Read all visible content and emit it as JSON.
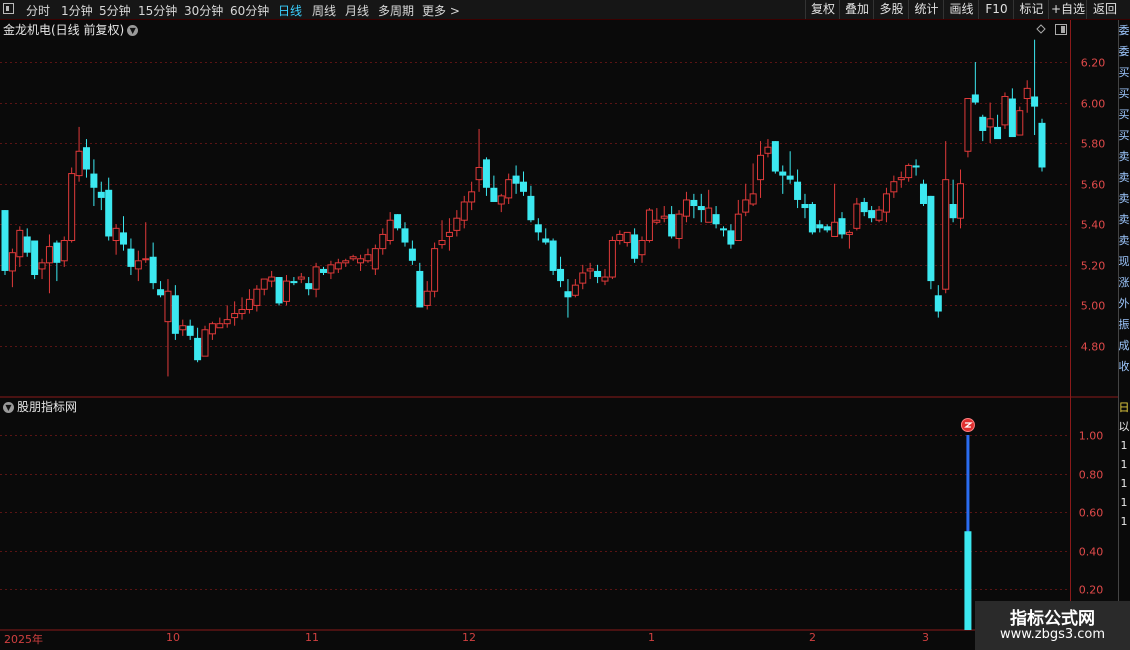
{
  "toolbar": {
    "left_items": [
      "分时",
      "1分钟",
      "5分钟",
      "15分钟",
      "30分钟",
      "60分钟",
      "日线",
      "周线",
      "月线",
      "多周期",
      "更多 >"
    ],
    "active_item": "日线",
    "right_items": [
      "复权",
      "叠加",
      "多股",
      "统计",
      "画线",
      "F10",
      "标记",
      "+自选",
      "返回"
    ]
  },
  "main_chart": {
    "title": "金龙机电(日线 前复权)",
    "price_ticks": [
      "6.20",
      "6.00",
      "5.80",
      "5.60",
      "5.40",
      "5.20",
      "5.00",
      "4.80"
    ],
    "up_color": "#e03a3a",
    "down_color": "#3ce8f0"
  },
  "indicator": {
    "title": "股朋指标网",
    "ticks": [
      "1.00",
      "0.80",
      "0.60",
      "0.40",
      "0.20"
    ],
    "signal_value": 1,
    "bar_value": 0.5
  },
  "date_axis": [
    "2025年",
    "10",
    "11",
    "12",
    "1",
    "2",
    "3"
  ],
  "right_strip": {
    "top_chars": [
      "委",
      "委",
      "买",
      "买",
      "买",
      "买",
      "卖",
      "卖",
      "卖",
      "卖",
      "卖",
      "现",
      "涨",
      "外",
      "振",
      "成",
      "收"
    ],
    "bottom_chars": [
      "日",
      "以",
      "1",
      "1",
      "1",
      "1",
      "1"
    ]
  },
  "watermark": {
    "title": "指标公式网",
    "url": "www.zbgs3.com"
  },
  "chart_data": {
    "type": "candlestick",
    "title": "金龙机电(日线 前复权)",
    "ylim": [
      4.6,
      6.3
    ],
    "xlabel_ticks": [
      "2025年",
      "10",
      "11",
      "12",
      "1",
      "2",
      "3"
    ],
    "ohlc": [
      [
        5.47,
        5.47,
        5.15,
        5.17
      ],
      [
        5.17,
        5.28,
        5.09,
        5.26
      ],
      [
        5.24,
        5.39,
        5.19,
        5.37
      ],
      [
        5.34,
        5.38,
        5.24,
        5.26
      ],
      [
        5.32,
        5.32,
        5.13,
        5.15
      ],
      [
        5.18,
        5.23,
        5.13,
        5.21
      ],
      [
        5.21,
        5.35,
        5.06,
        5.29
      ],
      [
        5.31,
        5.32,
        5.12,
        5.21
      ],
      [
        5.22,
        5.34,
        5.19,
        5.32
      ],
      [
        5.32,
        5.68,
        5.31,
        5.65
      ],
      [
        5.64,
        5.88,
        5.61,
        5.76
      ],
      [
        5.78,
        5.82,
        5.63,
        5.67
      ],
      [
        5.65,
        5.72,
        5.49,
        5.58
      ],
      [
        5.56,
        5.61,
        5.47,
        5.53
      ],
      [
        5.57,
        5.63,
        5.32,
        5.34
      ],
      [
        5.32,
        5.4,
        5.25,
        5.38
      ],
      [
        5.36,
        5.44,
        5.27,
        5.3
      ],
      [
        5.28,
        5.33,
        5.15,
        5.19
      ],
      [
        5.18,
        5.27,
        5.12,
        5.22
      ],
      [
        5.23,
        5.41,
        5.21,
        5.23
      ],
      [
        5.24,
        5.31,
        5.08,
        5.11
      ],
      [
        5.08,
        5.12,
        5.04,
        5.05
      ],
      [
        4.92,
        5.13,
        4.65,
        5.07
      ],
      [
        5.05,
        5.1,
        4.83,
        4.86
      ],
      [
        4.88,
        4.93,
        4.85,
        4.9
      ],
      [
        4.9,
        4.93,
        4.83,
        4.85
      ],
      [
        4.84,
        4.89,
        4.72,
        4.73
      ],
      [
        4.75,
        4.9,
        4.75,
        4.88
      ],
      [
        4.86,
        4.92,
        4.83,
        4.91
      ],
      [
        4.89,
        4.94,
        4.89,
        4.91
      ],
      [
        4.91,
        5.0,
        4.89,
        4.93
      ],
      [
        4.94,
        5.02,
        4.9,
        4.96
      ],
      [
        4.96,
        5.04,
        4.93,
        4.98
      ],
      [
        4.98,
        5.08,
        4.96,
        5.03
      ],
      [
        5.0,
        5.1,
        4.97,
        5.08
      ],
      [
        5.08,
        5.13,
        5.05,
        5.13
      ],
      [
        5.12,
        5.17,
        5.09,
        5.14
      ],
      [
        5.14,
        5.14,
        5.0,
        5.01
      ],
      [
        5.02,
        5.15,
        5.0,
        5.12
      ],
      [
        5.12,
        5.14,
        5.1,
        5.11
      ],
      [
        5.13,
        5.16,
        5.11,
        5.14
      ],
      [
        5.11,
        5.14,
        5.05,
        5.08
      ],
      [
        5.08,
        5.21,
        5.04,
        5.19
      ],
      [
        5.18,
        5.19,
        5.15,
        5.16
      ],
      [
        5.16,
        5.22,
        5.13,
        5.2
      ],
      [
        5.18,
        5.23,
        5.16,
        5.21
      ],
      [
        5.21,
        5.23,
        5.19,
        5.22
      ],
      [
        5.23,
        5.25,
        5.22,
        5.24
      ],
      [
        5.21,
        5.25,
        5.17,
        5.23
      ],
      [
        5.22,
        5.28,
        5.21,
        5.25
      ],
      [
        5.18,
        5.3,
        5.15,
        5.28
      ],
      [
        5.28,
        5.38,
        5.25,
        5.35
      ],
      [
        5.32,
        5.46,
        5.3,
        5.42
      ],
      [
        5.45,
        5.45,
        5.37,
        5.38
      ],
      [
        5.38,
        5.41,
        5.29,
        5.31
      ],
      [
        5.28,
        5.32,
        5.2,
        5.22
      ],
      [
        5.17,
        5.21,
        4.99,
        4.99
      ],
      [
        5.0,
        5.12,
        4.98,
        5.07
      ],
      [
        5.07,
        5.31,
        5.04,
        5.28
      ],
      [
        5.3,
        5.42,
        5.28,
        5.32
      ],
      [
        5.34,
        5.43,
        5.27,
        5.36
      ],
      [
        5.37,
        5.47,
        5.34,
        5.43
      ],
      [
        5.42,
        5.54,
        5.38,
        5.51
      ],
      [
        5.51,
        5.61,
        5.47,
        5.56
      ],
      [
        5.62,
        5.87,
        5.56,
        5.68
      ],
      [
        5.72,
        5.73,
        5.54,
        5.58
      ],
      [
        5.58,
        5.64,
        5.52,
        5.51
      ],
      [
        5.5,
        5.55,
        5.46,
        5.54
      ],
      [
        5.53,
        5.65,
        5.5,
        5.62
      ],
      [
        5.64,
        5.69,
        5.55,
        5.6
      ],
      [
        5.61,
        5.66,
        5.54,
        5.56
      ],
      [
        5.54,
        5.59,
        5.41,
        5.42
      ],
      [
        5.4,
        5.43,
        5.32,
        5.36
      ],
      [
        5.33,
        5.38,
        5.3,
        5.31
      ],
      [
        5.32,
        5.33,
        5.15,
        5.17
      ],
      [
        5.18,
        5.24,
        5.09,
        5.12
      ],
      [
        5.07,
        5.13,
        4.94,
        5.04
      ],
      [
        5.05,
        5.13,
        5.04,
        5.1
      ],
      [
        5.11,
        5.2,
        5.08,
        5.16
      ],
      [
        5.17,
        5.21,
        5.13,
        5.18
      ],
      [
        5.17,
        5.2,
        5.11,
        5.14
      ],
      [
        5.12,
        5.18,
        5.1,
        5.14
      ],
      [
        5.14,
        5.34,
        5.13,
        5.32
      ],
      [
        5.32,
        5.37,
        5.3,
        5.35
      ],
      [
        5.31,
        5.36,
        5.29,
        5.36
      ],
      [
        5.35,
        5.38,
        5.21,
        5.23
      ],
      [
        5.25,
        5.34,
        5.21,
        5.32
      ],
      [
        5.32,
        5.48,
        5.31,
        5.47
      ],
      [
        5.41,
        5.48,
        5.4,
        5.42
      ],
      [
        5.43,
        5.49,
        5.41,
        5.44
      ],
      [
        5.45,
        5.49,
        5.33,
        5.34
      ],
      [
        5.33,
        5.47,
        5.28,
        5.45
      ],
      [
        5.44,
        5.56,
        5.41,
        5.52
      ],
      [
        5.52,
        5.55,
        5.43,
        5.49
      ],
      [
        5.49,
        5.55,
        5.41,
        5.47
      ],
      [
        5.41,
        5.57,
        5.41,
        5.48
      ],
      [
        5.45,
        5.49,
        5.38,
        5.4
      ],
      [
        5.38,
        5.39,
        5.34,
        5.37
      ],
      [
        5.37,
        5.4,
        5.28,
        5.3
      ],
      [
        5.32,
        5.52,
        5.34,
        5.45
      ],
      [
        5.46,
        5.6,
        5.44,
        5.52
      ],
      [
        5.5,
        5.7,
        5.49,
        5.55
      ],
      [
        5.62,
        5.81,
        5.53,
        5.74
      ],
      [
        5.75,
        5.82,
        5.73,
        5.78
      ],
      [
        5.81,
        5.81,
        5.65,
        5.66
      ],
      [
        5.66,
        5.69,
        5.55,
        5.64
      ],
      [
        5.64,
        5.76,
        5.6,
        5.62
      ],
      [
        5.61,
        5.67,
        5.48,
        5.52
      ],
      [
        5.5,
        5.55,
        5.43,
        5.48
      ],
      [
        5.5,
        5.51,
        5.35,
        5.36
      ],
      [
        5.4,
        5.42,
        5.36,
        5.38
      ],
      [
        5.39,
        5.4,
        5.36,
        5.37
      ],
      [
        5.34,
        5.6,
        5.34,
        5.41
      ],
      [
        5.43,
        5.46,
        5.33,
        5.35
      ],
      [
        5.35,
        5.37,
        5.28,
        5.36
      ],
      [
        5.38,
        5.53,
        5.37,
        5.5
      ],
      [
        5.51,
        5.53,
        5.44,
        5.46
      ],
      [
        5.47,
        5.49,
        5.41,
        5.43
      ],
      [
        5.42,
        5.49,
        5.41,
        5.47
      ],
      [
        5.46,
        5.58,
        5.41,
        5.55
      ],
      [
        5.56,
        5.64,
        5.53,
        5.61
      ],
      [
        5.62,
        5.66,
        5.58,
        5.63
      ],
      [
        5.63,
        5.7,
        5.61,
        5.69
      ],
      [
        5.69,
        5.72,
        5.64,
        5.68
      ],
      [
        5.6,
        5.62,
        5.49,
        5.5
      ],
      [
        5.54,
        5.54,
        5.08,
        5.12
      ],
      [
        5.05,
        5.1,
        4.94,
        4.97
      ],
      [
        5.08,
        5.81,
        5.06,
        5.62
      ],
      [
        5.5,
        5.62,
        5.41,
        5.43
      ],
      [
        5.43,
        5.67,
        5.38,
        5.6
      ],
      [
        5.76,
        6.02,
        5.73,
        6.02
      ],
      [
        6.04,
        6.2,
        5.99,
        6.0
      ],
      [
        5.93,
        5.94,
        5.81,
        5.86
      ],
      [
        5.88,
        6.0,
        5.8,
        5.92
      ],
      [
        5.88,
        5.94,
        5.83,
        5.82
      ],
      [
        5.89,
        6.05,
        5.87,
        6.03
      ],
      [
        6.02,
        6.07,
        5.84,
        5.83
      ],
      [
        5.84,
        5.98,
        5.84,
        5.96
      ],
      [
        6.02,
        6.11,
        5.95,
        6.07
      ],
      [
        6.03,
        6.31,
        5.84,
        5.98
      ],
      [
        5.9,
        5.92,
        5.66,
        5.68
      ]
    ],
    "indicator_series": {
      "name": "股朋指标网",
      "signal_index": 130,
      "signal_value": 1.0,
      "bar_value": 0.5
    }
  }
}
